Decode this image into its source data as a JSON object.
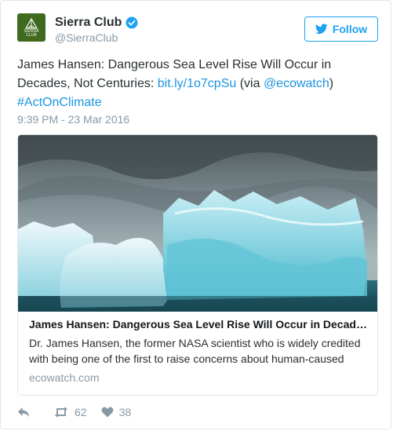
{
  "account": {
    "display_name": "Sierra Club",
    "handle": "@SierraClub",
    "avatar_text": "SIERRA CLUB",
    "verified_icon": "verified-badge-icon",
    "brand_color": "#3f6a1e"
  },
  "follow_button": {
    "label": "Follow",
    "icon": "twitter-bird-icon",
    "color": "#1da1f2"
  },
  "tweet": {
    "text_main": "James Hansen: Dangerous Sea Level Rise Will Occur in Decades, Not Centuries: ",
    "link_text": "bit.ly/1o7cpSu",
    "via_prefix": " (via ",
    "mention": "@ecowatch",
    "via_suffix": ")",
    "hashtag": "#ActOnClimate",
    "timestamp": "9:39 PM - 23 Mar 2016"
  },
  "card": {
    "image_alt": "icebergs",
    "title": "James Hansen: Dangerous Sea Level Rise Will Occur in Decades, Not Centuries",
    "description": "Dr. James Hansen, the former NASA scientist who is widely credited with being one of the first to raise concerns about human-caused climate change",
    "domain": "ecowatch.com"
  },
  "actions": {
    "reply_icon": "reply-icon",
    "retweet_icon": "retweet-icon",
    "retweet_count": "62",
    "like_icon": "heart-icon",
    "like_count": "38"
  }
}
